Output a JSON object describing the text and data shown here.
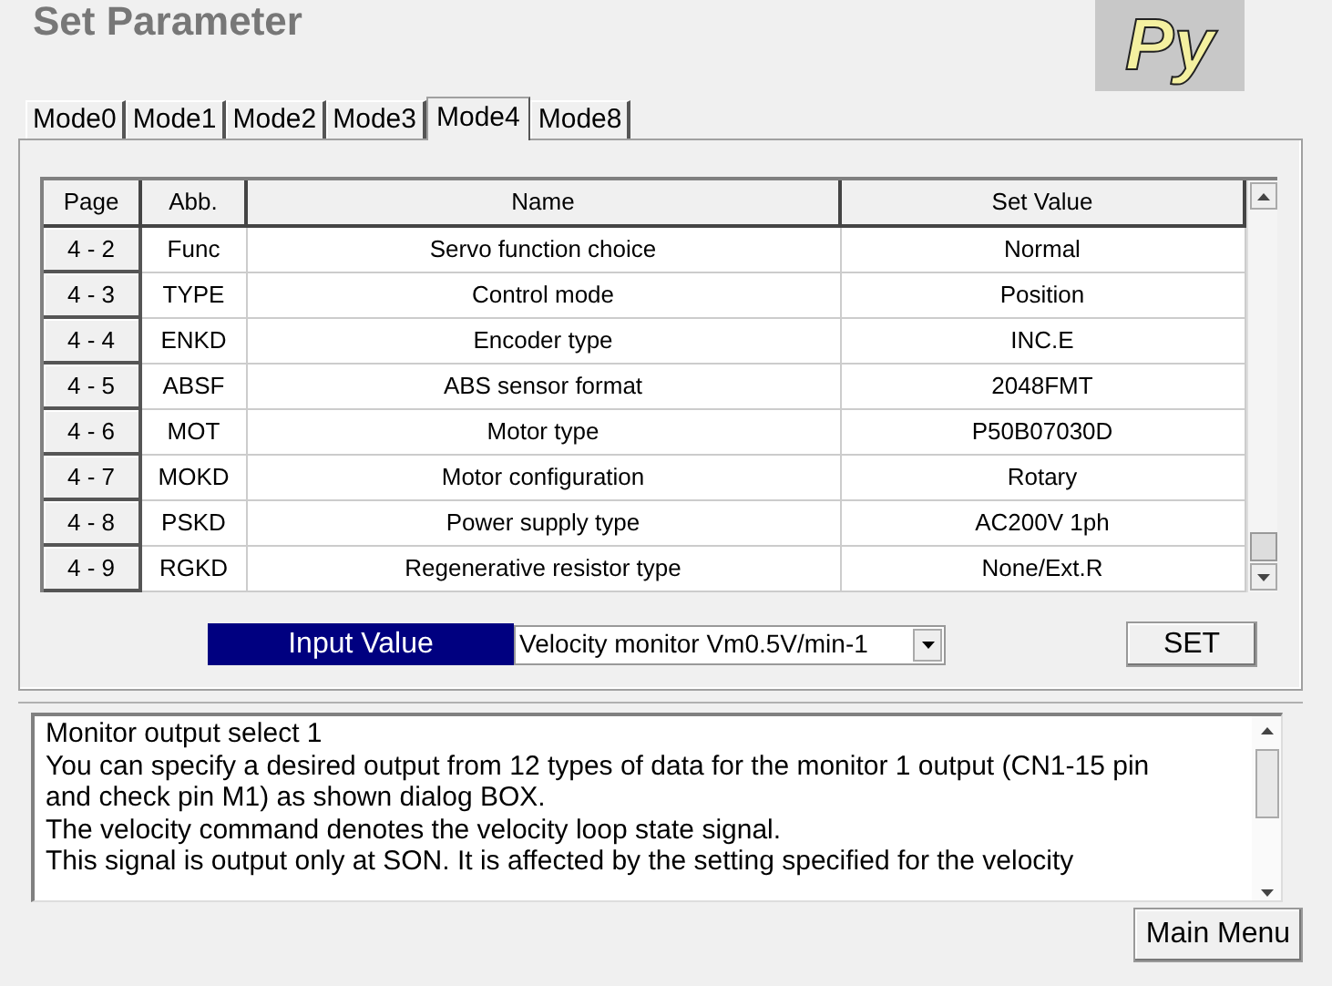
{
  "window": {
    "title": "Set Parameter",
    "logo": "Py"
  },
  "tabs": [
    {
      "label": "Mode0",
      "selected": false
    },
    {
      "label": "Mode1",
      "selected": false
    },
    {
      "label": "Mode2",
      "selected": false
    },
    {
      "label": "Mode3",
      "selected": false
    },
    {
      "label": "Mode4",
      "selected": true
    },
    {
      "label": "Mode8",
      "selected": false
    }
  ],
  "table": {
    "columns": [
      "Page",
      "Abb.",
      "Name",
      "Set Value"
    ],
    "rows": [
      [
        "4 - 2",
        "Func",
        "Servo function choice",
        "Normal"
      ],
      [
        "4 - 3",
        "TYPE",
        "Control mode",
        "Position"
      ],
      [
        "4 - 4",
        "ENKD",
        "Encoder type",
        "INC.E"
      ],
      [
        "4 - 5",
        "ABSF",
        "ABS sensor format",
        "2048FMT"
      ],
      [
        "4 - 6",
        "MOT",
        "Motor type",
        "P50B07030D"
      ],
      [
        "4 - 7",
        "MOKD",
        "Motor configuration",
        "Rotary"
      ],
      [
        "4 - 8",
        "PSKD",
        "Power supply type",
        "AC200V 1ph"
      ],
      [
        "4 - 9",
        "RGKD",
        "Regenerative resistor type",
        "None/Ext.R"
      ]
    ]
  },
  "input": {
    "label": "Input Value",
    "value": "Velocity monitor Vm0.5V/min-1",
    "button": "SET"
  },
  "description": [
    "Monitor output select 1",
    "You can specify a desired output from 12 types of data for the monitor 1 output (CN1-15 pin and check pin M1) as shown dialog BOX.",
    "The velocity command denotes the velocity loop state signal.",
    "This signal is output only at SON. It is affected by the setting specified for the velocity"
  ],
  "main_menu_button": "Main Menu"
}
